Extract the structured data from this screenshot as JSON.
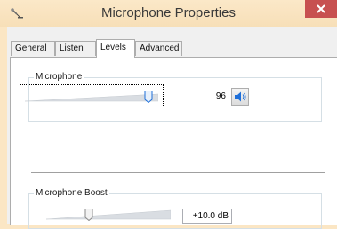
{
  "window": {
    "title": "Microphone Properties",
    "icon": "microphone-icon"
  },
  "tabs": [
    {
      "label": "General",
      "active": false
    },
    {
      "label": "Listen",
      "active": false
    },
    {
      "label": "Levels",
      "active": true
    },
    {
      "label": "Advanced",
      "active": false
    }
  ],
  "microphone": {
    "group_label": "Microphone",
    "level": 96,
    "value_text": "96",
    "mute_icon": "speaker-icon"
  },
  "boost": {
    "group_label": "Microphone Boost",
    "level_fraction": 0.33,
    "value_text": "+10.0 dB"
  },
  "colors": {
    "title_bar": "#fbe6c4",
    "close_button": "#c75050",
    "slider_thumb": "#1e6fd9"
  }
}
